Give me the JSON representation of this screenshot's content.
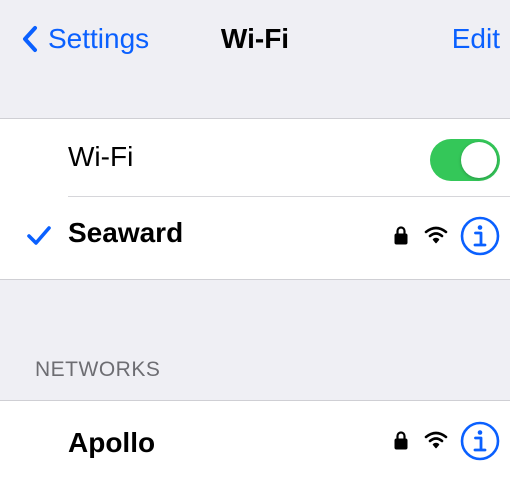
{
  "navbar": {
    "back_label": "Settings",
    "title": "Wi-Fi",
    "edit_label": "Edit"
  },
  "wifi_toggle": {
    "label": "Wi-Fi",
    "enabled": true
  },
  "connected_network": {
    "name": "Seaward",
    "secured": true,
    "icons": [
      "checkmark-icon",
      "lock-icon",
      "wifi-signal-icon",
      "info-icon"
    ]
  },
  "networks_section": {
    "header": "NETWORKS",
    "items": [
      {
        "name": "Apollo",
        "secured": true,
        "icons": [
          "lock-icon",
          "wifi-signal-icon",
          "info-icon"
        ]
      }
    ]
  },
  "colors": {
    "accent": "#0a60ff",
    "toggle_on": "#34c759",
    "background": "#efeff4",
    "cell": "#ffffff",
    "header_text": "#6d6d72"
  }
}
